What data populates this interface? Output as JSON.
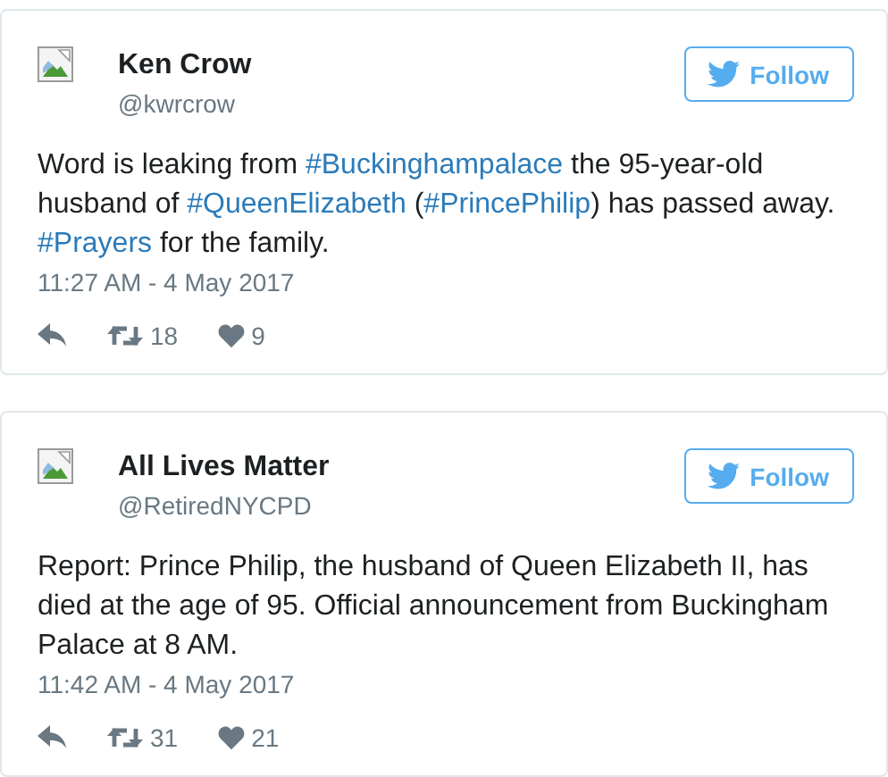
{
  "tweets": [
    {
      "name": "Ken Crow",
      "handle": "@kwrcrow",
      "follow_label": "Follow",
      "text": [
        {
          "kind": "plain",
          "text": "Word is leaking from "
        },
        {
          "kind": "hashtag",
          "text": "#Buckinghampalace"
        },
        {
          "kind": "plain",
          "text": " the 95-year-old husband of "
        },
        {
          "kind": "hashtag",
          "text": "#QueenElizabeth"
        },
        {
          "kind": "plain",
          "text": " ("
        },
        {
          "kind": "hashtag",
          "text": "#PrincePhilip"
        },
        {
          "kind": "plain",
          "text": ") has passed away. "
        },
        {
          "kind": "hashtag",
          "text": "#Prayers"
        },
        {
          "kind": "plain",
          "text": " for the family."
        }
      ],
      "time": "11:27 AM - 4 May 2017",
      "retweets": "18",
      "likes": "9"
    },
    {
      "name": "All Lives Matter",
      "handle": "@RetiredNYCPD",
      "follow_label": "Follow",
      "text": [
        {
          "kind": "plain",
          "text": "Report: Prince Philip, the husband of Queen Elizabeth II, has died at the age of 95. Official announcement from Buckingham Palace at 8 AM."
        }
      ],
      "time": "11:42 AM - 4 May 2017",
      "retweets": "31",
      "likes": "21"
    }
  ]
}
